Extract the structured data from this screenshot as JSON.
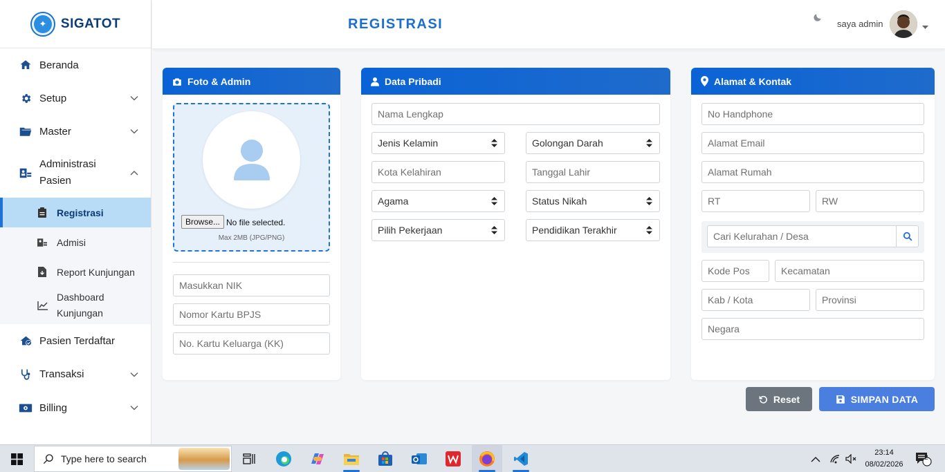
{
  "brand": {
    "name": "SIGATOT"
  },
  "sidebar": {
    "items": [
      {
        "label": "Beranda",
        "icon": "home-icon"
      },
      {
        "label": "Setup",
        "icon": "gear-icon"
      },
      {
        "label": "Master",
        "icon": "folder-icon"
      },
      {
        "label_line1": "Administrasi",
        "label_line2": "Pasien",
        "icon": "user-id-icon"
      },
      {
        "label": "Pasien Terdaftar",
        "icon": "user-check-icon"
      },
      {
        "label": "Transaksi",
        "icon": "stethoscope-icon"
      },
      {
        "label": "Billing",
        "icon": "money-icon"
      }
    ],
    "submenu": [
      {
        "label": "Registrasi",
        "active": true
      },
      {
        "label": "Admisi"
      },
      {
        "label": "Report Kunjungan"
      },
      {
        "label_line1": "Dashboard",
        "label_line2": "Kunjungan"
      }
    ]
  },
  "header": {
    "title": "REGISTRASI",
    "user_name": "saya admin"
  },
  "cards": {
    "foto": {
      "title": "Foto & Admin",
      "browse_label": "Browse...",
      "file_status": "No file selected.",
      "file_hint": "Max 2MB (JPG/PNG)",
      "nik_placeholder": "Masukkan NIK",
      "bpjs_placeholder": "Nomor Kartu BPJS",
      "kk_placeholder": "No. Kartu Keluarga (KK)"
    },
    "pribadi": {
      "title": "Data Pribadi",
      "nama_placeholder": "Nama Lengkap",
      "jenis_kelamin": "Jenis Kelamin",
      "golongan_darah": "Golongan Darah",
      "kota_kelahiran_placeholder": "Kota Kelahiran",
      "tanggal_lahir_placeholder": "Tanggal Lahir",
      "agama": "Agama",
      "status_nikah": "Status Nikah",
      "pekerjaan": "Pilih Pekerjaan",
      "pendidikan": "Pendidikan Terakhir"
    },
    "alamat": {
      "title": "Alamat & Kontak",
      "hp_placeholder": "No Handphone",
      "email_placeholder": "Alamat Email",
      "rumah_placeholder": "Alamat Rumah",
      "rt_placeholder": "RT",
      "rw_placeholder": "RW",
      "kelurahan_placeholder": "Cari Kelurahan / Desa",
      "kodepos_placeholder": "Kode Pos",
      "kecamatan_placeholder": "Kecamatan",
      "kabkota_placeholder": "Kab / Kota",
      "provinsi_placeholder": "Provinsi",
      "negara_placeholder": "Negara"
    }
  },
  "actions": {
    "reset_label": "Reset",
    "save_label": "SIMPAN DATA"
  },
  "taskbar": {
    "search_placeholder": "Type here to search",
    "time": "23:14",
    "date": "08/02/2026",
    "notification_count": "2"
  },
  "colors": {
    "primary": "#1f6bcc",
    "title": "#1b6fd0",
    "active_bg": "#b8dbf6",
    "reset": "#6c757d",
    "save": "#4a7fe0"
  }
}
